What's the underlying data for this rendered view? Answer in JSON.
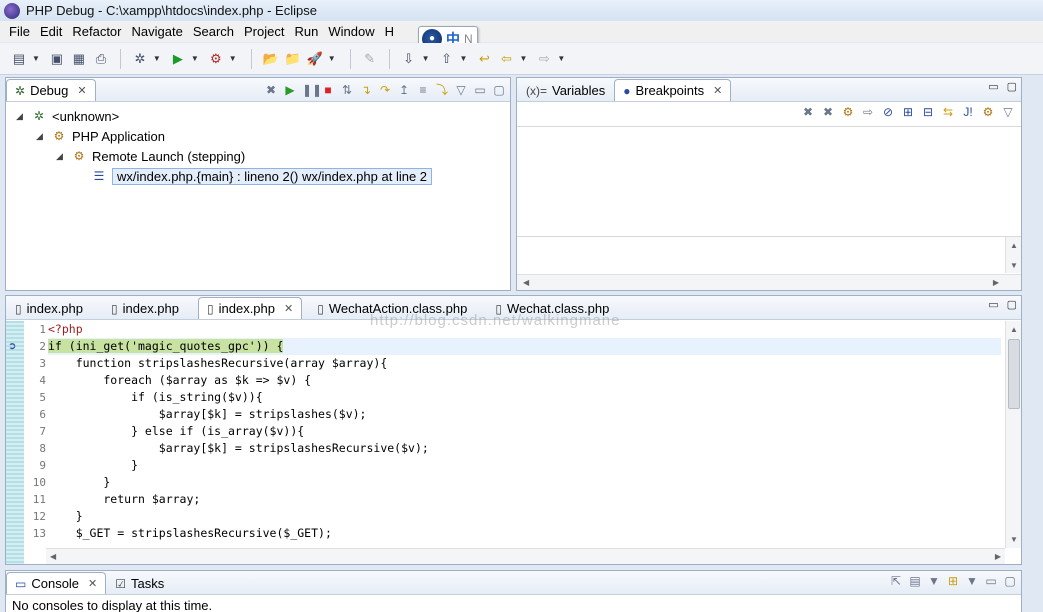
{
  "window": {
    "title": "PHP Debug - C:\\xampp\\htdocs\\index.php - Eclipse"
  },
  "menubar": {
    "items": [
      "File",
      "Edit",
      "Refactor",
      "Navigate",
      "Search",
      "Project",
      "Run",
      "Window",
      "H"
    ]
  },
  "ime": {
    "zh_label": "中",
    "extra": "N"
  },
  "debug_view": {
    "tab_label": "Debug",
    "tree": [
      {
        "label": "<unknown>",
        "icon": "debug-target-icon"
      },
      {
        "label": "PHP Application",
        "icon": "php-app-icon"
      },
      {
        "label": "Remote Launch (stepping)",
        "icon": "remote-launch-icon"
      },
      {
        "label": "wx/index.php.{main} : lineno 2() wx/index.php at line 2",
        "icon": "stack-frame-icon"
      }
    ]
  },
  "variables_view": {
    "tabs": [
      "Variables",
      "Breakpoints"
    ],
    "active_tab": "Breakpoints"
  },
  "editor": {
    "tabs": [
      "index.php",
      "index.php",
      "index.php",
      "WechatAction.class.php",
      "Wechat.class.php"
    ],
    "active_tab_index": 2,
    "current_line": 2,
    "lines": [
      "<?php",
      "if (ini_get('magic_quotes_gpc')) {",
      "    function stripslashesRecursive(array $array){",
      "        foreach ($array as $k => $v) {",
      "            if (is_string($v)){",
      "                $array[$k] = stripslashes($v);",
      "            } else if (is_array($v)){",
      "                $array[$k] = stripslashesRecursive($v);",
      "            }",
      "        }",
      "        return $array;",
      "    }",
      "    $_GET = stripslashesRecursive($_GET);"
    ],
    "line_numbers": [
      "1",
      "2",
      "3",
      "4",
      "5",
      "6",
      "7",
      "8",
      "9",
      "10",
      "11",
      "12",
      "13"
    ],
    "watermark": "http://blog.csdn.net/walkingmane"
  },
  "console_view": {
    "tabs": [
      "Console",
      "Tasks"
    ],
    "message": "No consoles to display at this time."
  }
}
